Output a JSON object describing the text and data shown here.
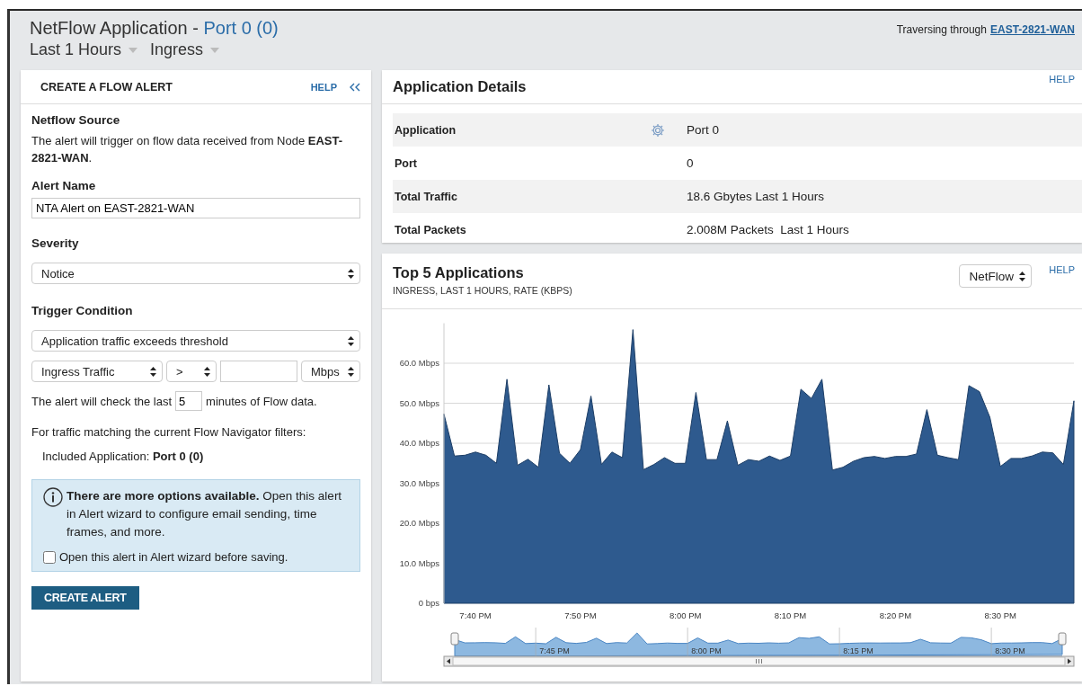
{
  "header": {
    "title": "NetFlow Application - ",
    "title_link": "Port 0 (0)",
    "time_range": "Last 1 Hours",
    "direction": "Ingress",
    "traversing_label": "Traversing through",
    "traversing_link": "EAST-2821-WAN"
  },
  "alert_panel": {
    "title": "CREATE A FLOW ALERT",
    "help": "HELP",
    "source_heading": "Netflow Source",
    "source_text": "The alert will trigger on flow data received from Node **EAST-2821-WAN**.",
    "name_label": "Alert Name",
    "name_value": "NTA Alert on EAST-2821-WAN",
    "severity_label": "Severity",
    "severity_value": "Notice",
    "trigger_label": "Trigger Condition",
    "condition_value": "Application traffic exceeds threshold",
    "metric_value": "Ingress Traffic",
    "operator_value": ">",
    "unit_value": "Mbps",
    "check_before": "The alert will check the last",
    "minutes_value": "5",
    "check_after": "minutes of Flow data.",
    "filter_text": "For traffic matching the current Flow Navigator filters:",
    "included_text": "Included Application: **Port 0 (0)**",
    "info_text": "**There are more options available.** Open this alert in Alert wizard to configure email sending, time frames, and more.",
    "wizard_checkbox": {
      "label": "Open this alert in Alert wizard before saving.",
      "checked": false
    },
    "create_button": "CREATE ALERT"
  },
  "details": {
    "title": "Application Details",
    "help": "HELP",
    "rows": [
      {
        "label": "Application",
        "value": "Port 0",
        "kind": "settings"
      },
      {
        "label": "Port",
        "value": "0",
        "kind": "plain"
      },
      {
        "label": "Total Traffic",
        "value": "18.6 Gbytes Last 1 Hours",
        "kind": "plain"
      },
      {
        "label": "Total Packets",
        "value": "2.008M Packets  Last 1 Hours",
        "kind": "plain"
      }
    ]
  },
  "top_apps": {
    "title": "Top 5 Applications",
    "subtitle": "INGRESS, LAST 1 HOURS, RATE (KBPS)",
    "source_value": "NetFlow",
    "help": "HELP",
    "chart_data": {
      "type": "area",
      "categories": [
        null,
        null,
        null,
        "7:40 PM",
        null,
        null,
        null,
        null,
        null,
        null,
        null,
        null,
        null,
        "7:50 PM",
        null,
        null,
        null,
        null,
        null,
        null,
        null,
        null,
        null,
        "8:00 PM",
        null,
        null,
        null,
        null,
        null,
        null,
        null,
        null,
        null,
        "8:10 PM",
        null,
        null,
        null,
        null,
        null,
        null,
        null,
        null,
        null,
        "8:20 PM",
        null,
        null,
        null,
        null,
        null,
        null,
        null,
        null,
        null,
        "8:30 PM",
        null,
        null,
        null,
        null,
        null,
        null,
        null
      ],
      "series": [
        {
          "color": "#2e5a8e",
          "values": [
            47.3,
            36.8,
            37,
            37.8,
            37,
            35,
            56,
            34.5,
            36,
            34,
            54.6,
            37.5,
            35,
            38.4,
            51.8,
            34.7,
            37.8,
            36.4,
            68.4,
            33.4,
            34.7,
            36.4,
            35,
            35,
            52.7,
            35.9,
            35.9,
            45.6,
            34.5,
            35.9,
            35.5,
            36.8,
            35.7,
            36.8,
            53.5,
            51.2,
            56,
            33.3,
            34,
            35.5,
            36.4,
            36.7,
            36.2,
            36.7,
            36.7,
            37.3,
            48.4,
            37,
            36.4,
            35.9,
            54.4,
            52.9,
            46.5,
            34.2,
            36.2,
            36.2,
            36.8,
            37.8,
            37.6,
            34.7,
            50.6
          ]
        }
      ],
      "ylim": [
        0,
        70
      ],
      "grid": true,
      "yticks": [
        {
          "value": 0,
          "label": "0 bps"
        },
        {
          "value": 10,
          "label": "10.0 Mbps"
        },
        {
          "value": 20,
          "label": "20.0 Mbps"
        },
        {
          "value": 30,
          "label": "30.0 Mbps"
        },
        {
          "value": 40,
          "label": "40.0 Mbps"
        },
        {
          "value": 50,
          "label": "50.0 Mbps"
        },
        {
          "value": 60,
          "label": "60.0 Mbps"
        }
      ]
    },
    "navigator": {
      "labels": [
        "7:45 PM",
        "8:00 PM",
        "8:15 PM",
        "8:30 PM"
      ]
    }
  }
}
